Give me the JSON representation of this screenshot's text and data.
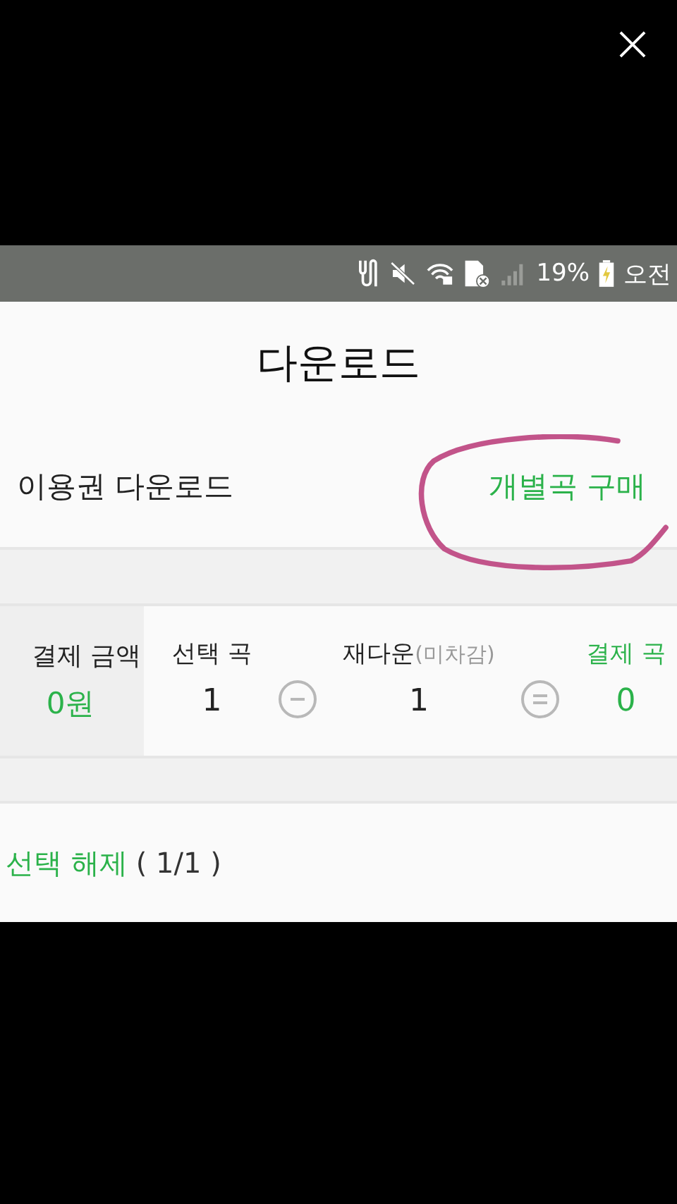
{
  "status_bar": {
    "battery": "19%",
    "time": "오전"
  },
  "header": {
    "title": "다운로드"
  },
  "tabs": [
    {
      "label": "이용권 다운로드",
      "selected": false
    },
    {
      "label": "개별곡 구매",
      "selected": true
    }
  ],
  "summary": {
    "amount_label": "결제 금액",
    "amount": "0원",
    "columns": [
      {
        "label": "선택 곡",
        "value": "1",
        "highlight": false
      },
      {
        "label": "재다운",
        "note": "(미차감)",
        "value": "1",
        "highlight": false
      },
      {
        "label": "결제 곡",
        "value": "0",
        "highlight": true
      }
    ]
  },
  "selection": {
    "action": "선택 해제",
    "count": "( 1/1 )"
  }
}
